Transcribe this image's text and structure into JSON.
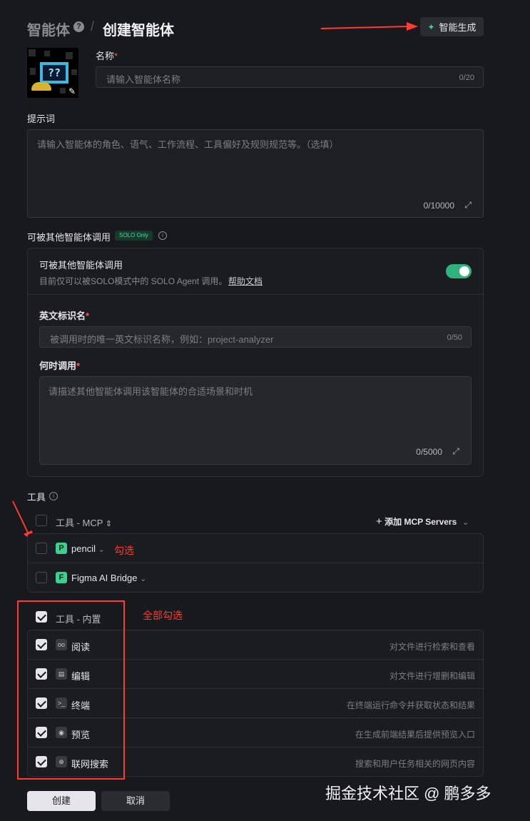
{
  "header": {
    "root": "智能体",
    "help": "?",
    "separator": "/",
    "current": "创建智能体",
    "generate_label": "智能生成",
    "generate_icon": "sparkle-icon"
  },
  "avatar": {
    "screen_text": "??",
    "edit_icon": "pencil-icon"
  },
  "name": {
    "label": "名称",
    "required": "*",
    "placeholder": "请输入智能体名称",
    "count": "0/20"
  },
  "prompt": {
    "label": "提示词",
    "placeholder": "请输入智能体的角色、语气、工作流程、工具偏好及规则规范等。（选填）",
    "count": "0/10000",
    "expand_icon": "expand-icon"
  },
  "callable": {
    "label": "可被其他智能体调用",
    "badge": "SOLO Only",
    "title": "可被其他智能体调用",
    "desc": "目前仅可以被SOLO模式中的 SOLO Agent 调用。",
    "help_link": "帮助文档",
    "toggle_on": true,
    "en_label": "英文标识名",
    "en_placeholder": "被调用时的唯一英文标识名称，例如：project-analyzer",
    "en_count": "0/50",
    "when_label": "何时调用",
    "when_placeholder": "请描述其他智能体调用该智能体的合适场景和时机",
    "when_count": "0/5000",
    "required": "*"
  },
  "tools": {
    "label": "工具",
    "mcp_header": "工具 - MCP",
    "sort_icon": "sort-icon",
    "add_mcp": "添加 MCP Servers",
    "mcp_items": [
      {
        "logo": "P",
        "name": "pencil",
        "checked": false
      },
      {
        "logo": "F",
        "name": "Figma AI Bridge",
        "checked": false
      }
    ],
    "builtin_header": "工具 - 内置",
    "builtin_items": [
      {
        "icon": "glasses-icon",
        "name": "阅读",
        "desc": "对文件进行检索和查看",
        "checked": true
      },
      {
        "icon": "document-icon",
        "name": "编辑",
        "desc": "对文件进行增删和编辑",
        "checked": true
      },
      {
        "icon": "terminal-icon",
        "name": "终端",
        "desc": "在终端运行命令并获取状态和结果",
        "checked": true
      },
      {
        "icon": "eye-icon",
        "name": "预览",
        "desc": "在生成前端结果后提供预览入口",
        "checked": true
      },
      {
        "icon": "globe-icon",
        "name": "联网搜索",
        "desc": "搜索和用户任务相关的网页内容",
        "checked": true
      }
    ]
  },
  "annotations": {
    "check_one": "勾选",
    "check_all": "全部勾选"
  },
  "footer": {
    "create": "创建",
    "cancel": "取消"
  },
  "watermark": "掘金技术社区 @ 鹏多多"
}
